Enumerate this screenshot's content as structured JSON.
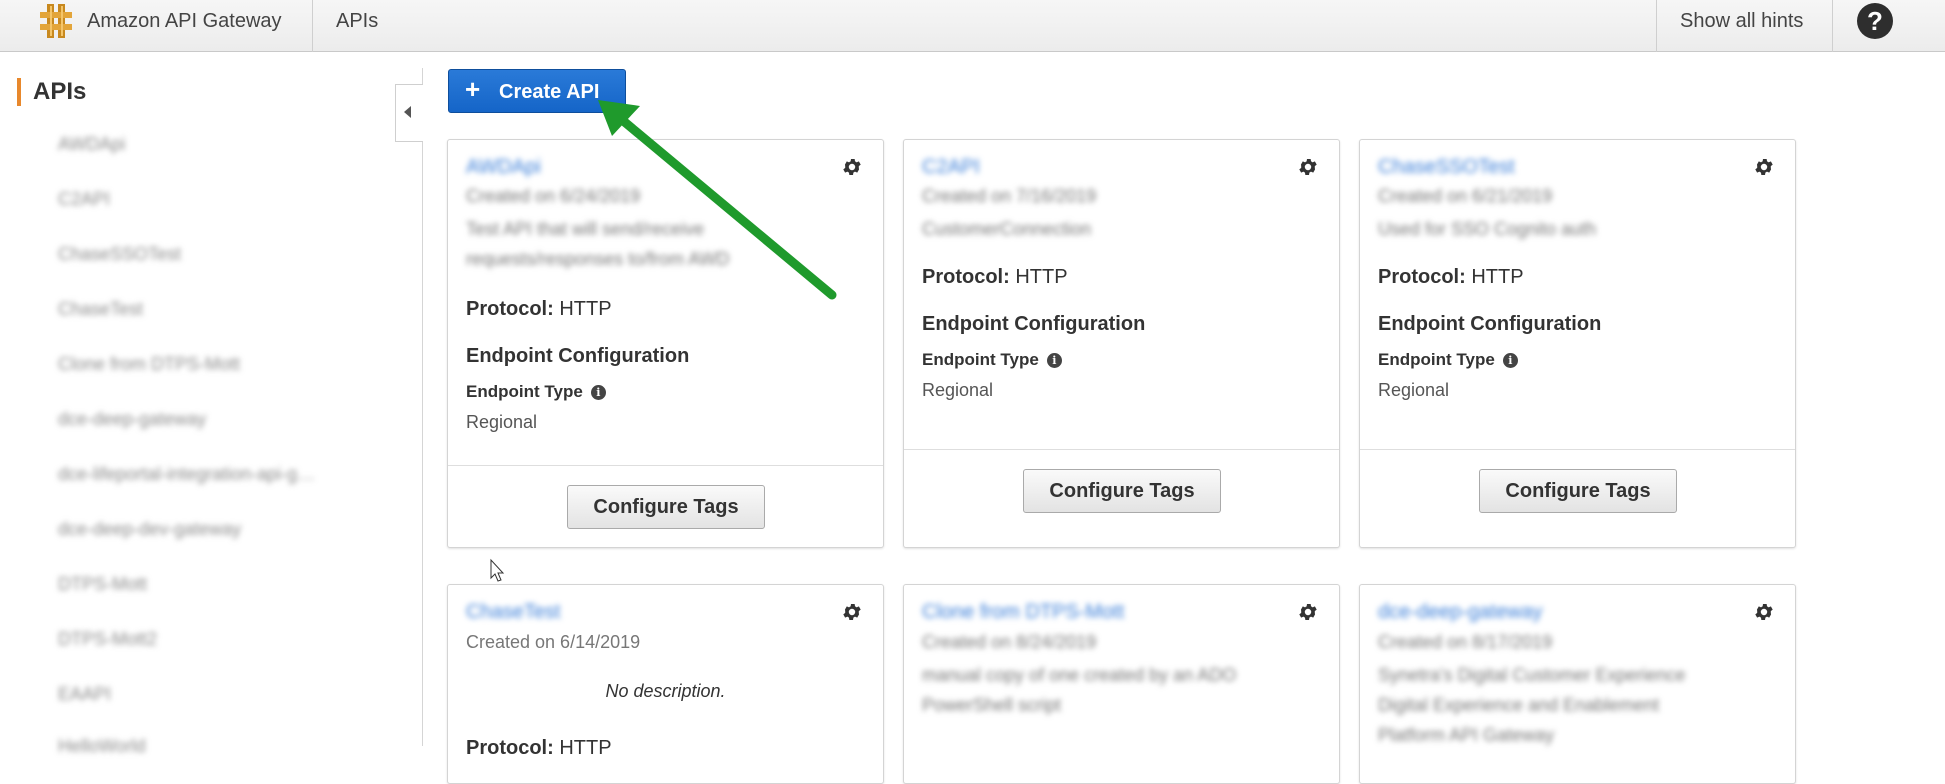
{
  "topbar": {
    "brand": "Amazon API Gateway",
    "nav_apis": "APIs",
    "show_hints": "Show all hints",
    "help_icon": "?"
  },
  "sidebar": {
    "title": "APIs",
    "items": [
      "AWDApi",
      "C2API",
      "ChaseSSOTest",
      "ChaseTest",
      "Clone from DTPS-Mott",
      "dce-deep-gateway",
      "dce-lifeportal-integration-api-g…",
      "dce-deep-dev-gateway",
      "DTPS-Mott",
      "DTPS-Mott2",
      "EAAPI",
      "HelloWorld"
    ]
  },
  "toolbar": {
    "create_label": "Create API"
  },
  "cards": [
    {
      "name": "AWDApi",
      "created": "Created on 6/24/2019",
      "description_lines": [
        "Test API that will send/receive",
        "requests/responses to/from AWD"
      ],
      "protocol_label": "Protocol:",
      "protocol_value": "HTTP",
      "endpoint_config": "Endpoint Configuration",
      "endpoint_type": "Endpoint Type",
      "endpoint_value": "Regional",
      "tags_label": "Configure Tags"
    },
    {
      "name": "C2API",
      "created": "Created on 7/16/2019",
      "description_lines": [
        "CustomerConnection"
      ],
      "protocol_label": "Protocol:",
      "protocol_value": "HTTP",
      "endpoint_config": "Endpoint Configuration",
      "endpoint_type": "Endpoint Type",
      "endpoint_value": "Regional",
      "tags_label": "Configure Tags"
    },
    {
      "name": "ChaseSSOTest",
      "created": "Created on 6/21/2019",
      "description_lines": [
        "Used for SSO Cognito auth"
      ],
      "protocol_label": "Protocol:",
      "protocol_value": "HTTP",
      "endpoint_config": "Endpoint Configuration",
      "endpoint_type": "Endpoint Type",
      "endpoint_value": "Regional",
      "tags_label": "Configure Tags"
    },
    {
      "name": "ChaseTest",
      "created": "Created on 6/14/2019",
      "description": "No description.",
      "protocol_label": "Protocol:",
      "protocol_value": "HTTP"
    },
    {
      "name": "Clone from DTPS-Mott",
      "created": "Created on 8/24/2019",
      "description_lines": [
        "manual copy of one created by an ADO",
        "PowerShell script"
      ]
    },
    {
      "name": "dce-deep-gateway",
      "created": "Created on 8/17/2019",
      "description_lines": [
        "Synetra's Digital Customer Experience",
        "Digital Experience and Enablement",
        "Platform API Gateway"
      ]
    }
  ]
}
